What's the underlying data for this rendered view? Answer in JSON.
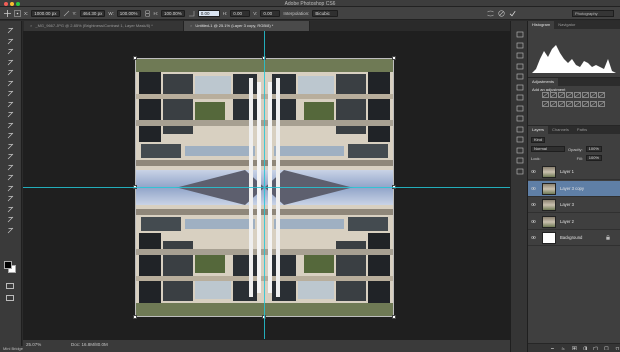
{
  "window": {
    "title": "Adobe Photoshop CS6"
  },
  "options_bar": {
    "x_label": "X:",
    "x_value": "1000.00 px",
    "y_label": "Y:",
    "y_value": "464.30 px",
    "w_label": "W:",
    "w_value": "100.00%",
    "h_label": "H:",
    "h_value": "100.00%",
    "angle_value": "0.00",
    "h_skew_label": "H:",
    "h_skew_value": "0.00",
    "v_skew_label": "V:",
    "v_skew_value": "0.00",
    "interpolation_label": "Interpolation:",
    "interpolation_value": "Bicubic",
    "workspace": "Photography"
  },
  "doc_tabs": [
    {
      "label": "_MG_9667.JPG @ 2.85% (Brightness/Contrast 1, Layer Mask/8) *",
      "active": false
    },
    {
      "label": "Untitled-1 @ 25.1% (Layer 3 copy, RGB/8) *",
      "active": true
    }
  ],
  "status": {
    "zoom": "25.07%",
    "doc": "Doc: 16.8M/80.0M"
  },
  "mini_bridge": "Mini Bridge",
  "panels": {
    "histogram_tabs": [
      "Histogram",
      "Navigator"
    ],
    "adjustments_tab": "Adjustments",
    "adjustments_hint": "Add an adjustment",
    "layers_tabs": [
      "Layers",
      "Channels",
      "Paths"
    ],
    "kind_label": "Kind",
    "blend_mode": "Normal",
    "opacity_label": "Opacity:",
    "opacity_value": "100%",
    "lock_label": "Lock:",
    "fill_label": "Fill:",
    "fill_value": "100%",
    "layers": [
      {
        "name": "Layer 1",
        "selected": false,
        "locked": false
      },
      {
        "name": "Layer 3 copy",
        "selected": true,
        "locked": false
      },
      {
        "name": "Layer 3",
        "selected": false,
        "locked": false
      },
      {
        "name": "Layer 2",
        "selected": false,
        "locked": false
      },
      {
        "name": "Background",
        "selected": false,
        "locked": true
      }
    ]
  },
  "colors": {
    "guide": "#25c7d6",
    "selection": "#5f7fa6",
    "ui_dark": "#2b2b2b"
  }
}
